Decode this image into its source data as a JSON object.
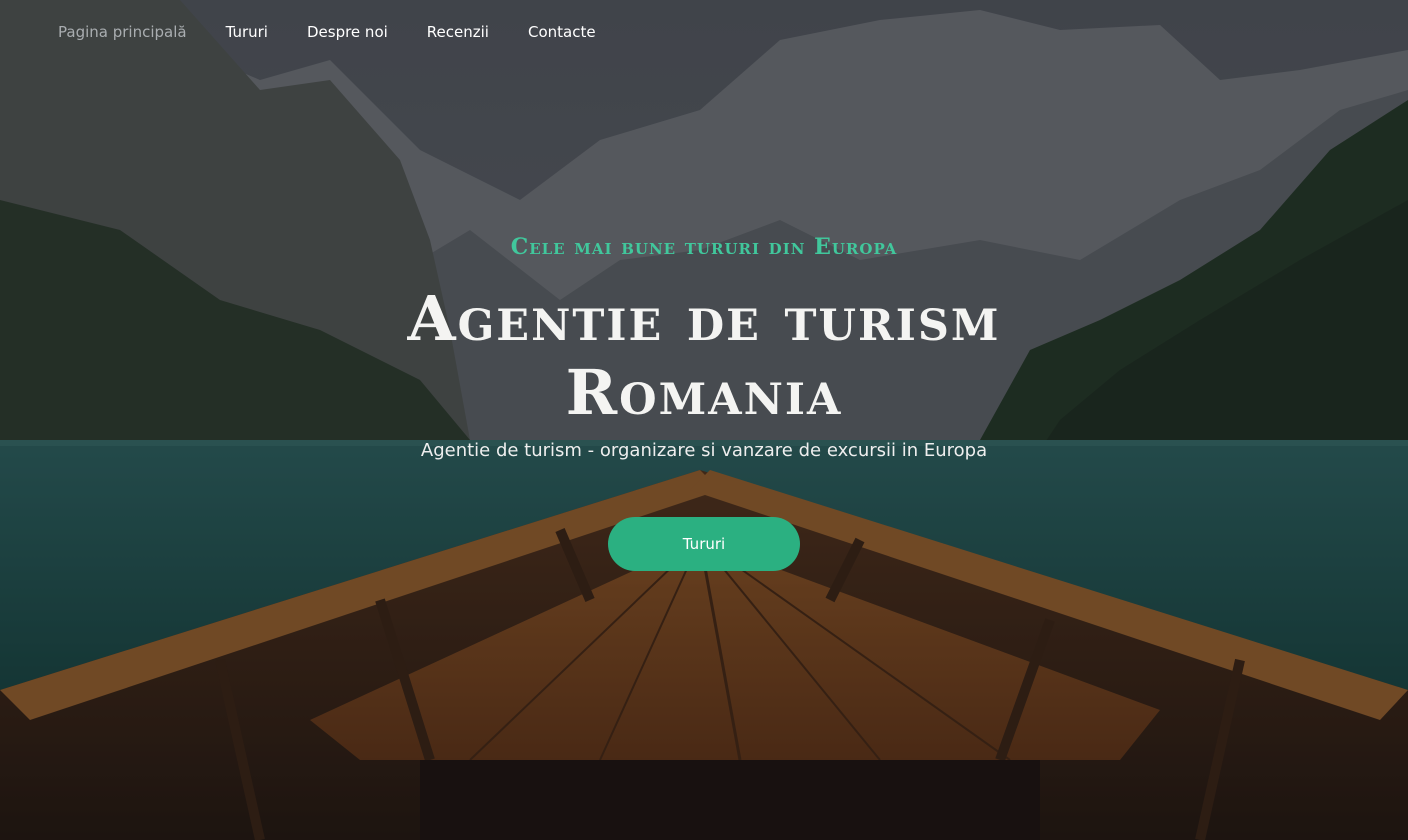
{
  "nav": {
    "items": [
      {
        "label": "Pagina principală",
        "active": true
      },
      {
        "label": "Tururi",
        "active": false
      },
      {
        "label": "Despre noi",
        "active": false
      },
      {
        "label": "Recenzii",
        "active": false
      },
      {
        "label": "Contacte",
        "active": false
      }
    ]
  },
  "hero": {
    "tagline": "Cele mai bune tururi din Europa",
    "title": "Agentie de turism Romania",
    "subtitle": "Agentie de turism - organizare si vanzare de excursii in Europa",
    "cta_label": "Tururi",
    "background": "mountain-lake-boat-photo"
  },
  "colors": {
    "accent": "#2bb081",
    "tagline": "#41c79c",
    "nav_active": "#a9adb0",
    "text": "#ffffff"
  }
}
